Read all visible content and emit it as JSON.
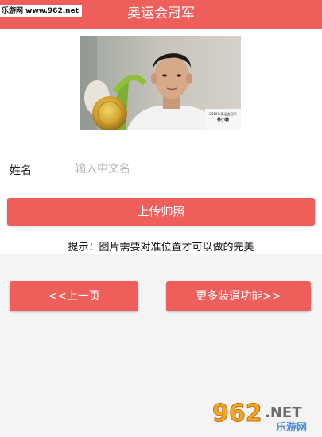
{
  "header": {
    "title": "奥运会冠军",
    "watermark": "乐游网 www.962.net"
  },
  "photo": {
    "caption_line1": "2016年奥运会冠军",
    "caption_line2": "林小霸"
  },
  "form": {
    "name_label": "姓名",
    "name_placeholder": "输入中文名",
    "name_value": ""
  },
  "upload_button": "上传帅照",
  "tip": "提示：图片需要对准位置才可以做的完美",
  "nav": {
    "prev_label": "<<上一页",
    "more_label": "更多装逼功能>>"
  },
  "logo": {
    "text_962": "962",
    "text_net": ".NET",
    "text_cn": "乐游网"
  },
  "colors": {
    "accent": "#ee5f5b",
    "background": "#f4f4f4"
  }
}
